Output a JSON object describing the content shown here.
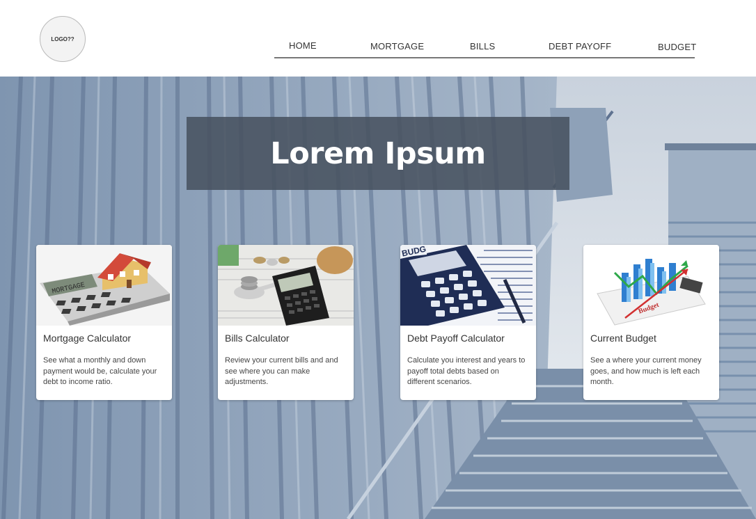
{
  "header": {
    "logo_text": "LOGO??",
    "nav": [
      "HOME",
      "MORTGAGE",
      "BILLS",
      "DEBT PAYOFF",
      "BUDGET"
    ]
  },
  "hero": {
    "title": "Lorem Ipsum"
  },
  "cards": [
    {
      "title": "Mortgage Calculator",
      "description": "See what a monthly and down payment would be, calculate your debt to income ratio.",
      "image_label": "MORTGAGE"
    },
    {
      "title": "Bills Calculator",
      "description": "Review your current bills and and see where you can make adjustments."
    },
    {
      "title": "Debt Payoff Calculator",
      "description": "Calculate you interest and years to payoff total debts based on different scenarios.",
      "image_label": "BUDG"
    },
    {
      "title": "Current Budget",
      "description": "See a where your current money goes, and how much is left each month.",
      "image_label": "Budget"
    }
  ]
}
